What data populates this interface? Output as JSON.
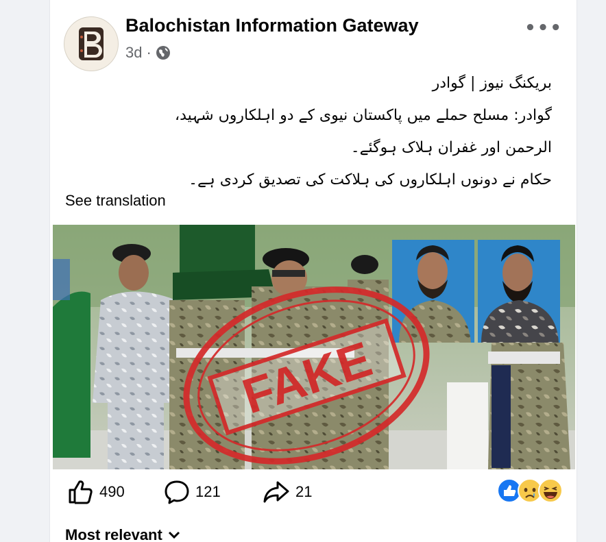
{
  "post": {
    "page_name": "Balochistan Information Gateway",
    "time": "3d",
    "visibility_icon": "globe-icon",
    "more_icon": "more-options-icon",
    "text_lines": [
      "بریکنگ نیوز | گوادر",
      "گوادر: مسلح حملے میں پاکستان نیوی کے دو اہلکاروں شہید،",
      "الرحمن اور غفران ہلاک ہوگئے۔",
      "حکام نے دونوں اہلکاروں کی ہلاکت کی تصدیق کردی ہے۔"
    ],
    "see_translation": "See translation",
    "image": {
      "stamp_text": "FAKE",
      "stamp_color": "#d42a2a"
    }
  },
  "actions": {
    "likes": "490",
    "comments": "121",
    "shares": "21",
    "reaction_icons": [
      "like-reaction-icon",
      "sad-reaction-icon",
      "haha-reaction-icon"
    ]
  },
  "comments_sort": {
    "label": "Most relevant"
  },
  "colors": {
    "text": "#050505",
    "secondary": "#65676b",
    "like_blue": "#1877f2",
    "background": "#f0f2f5"
  }
}
